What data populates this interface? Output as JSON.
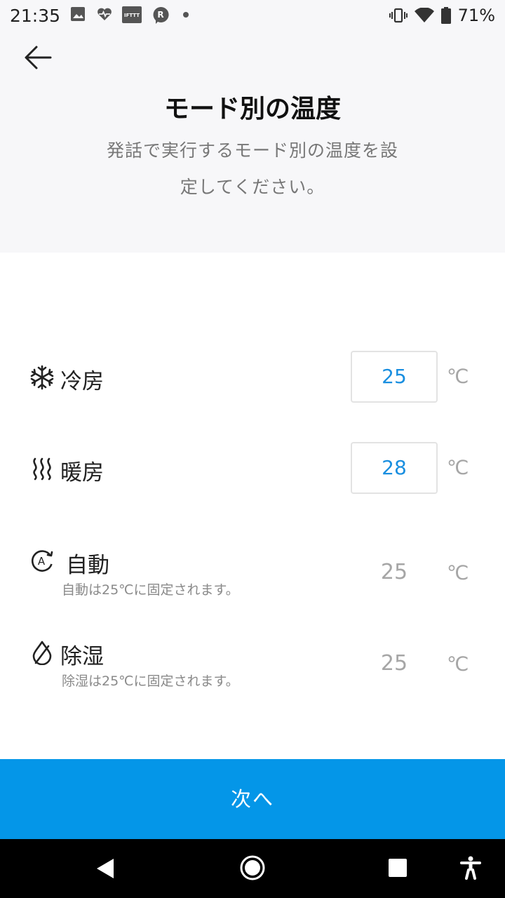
{
  "status_bar": {
    "time": "21:35",
    "battery": "71%",
    "icons": [
      "image-icon",
      "heart-pulse-icon",
      "ifttt-icon",
      "r-app-icon",
      "dot-icon",
      "vibrate-icon",
      "wifi-icon",
      "battery-icon"
    ],
    "ifttt_label": "IFTTT"
  },
  "header": {
    "title": "モード別の温度",
    "description": "発話で実行するモード別の温度を設定してください。"
  },
  "modes": [
    {
      "icon": "snowflake-icon",
      "label": "冷房",
      "value": "25",
      "unit": "℃",
      "editable": true
    },
    {
      "icon": "heat-waves-icon",
      "label": "暖房",
      "value": "28",
      "unit": "℃",
      "editable": true
    },
    {
      "icon": "auto-mode-icon",
      "icon_letter": "A",
      "label": "自動",
      "value": "25",
      "unit": "℃",
      "editable": false,
      "note": "自動は25℃に固定されます。"
    },
    {
      "icon": "droplet-icon",
      "label": "除湿",
      "value": "25",
      "unit": "℃",
      "editable": false,
      "note": "除湿は25℃に固定されます。"
    }
  ],
  "next_button": {
    "label": "次へ"
  },
  "colors": {
    "accent": "#0496e8",
    "value_blue": "#1a8fe0",
    "header_bg": "#f7f7f9",
    "muted": "#a6a6a6"
  }
}
